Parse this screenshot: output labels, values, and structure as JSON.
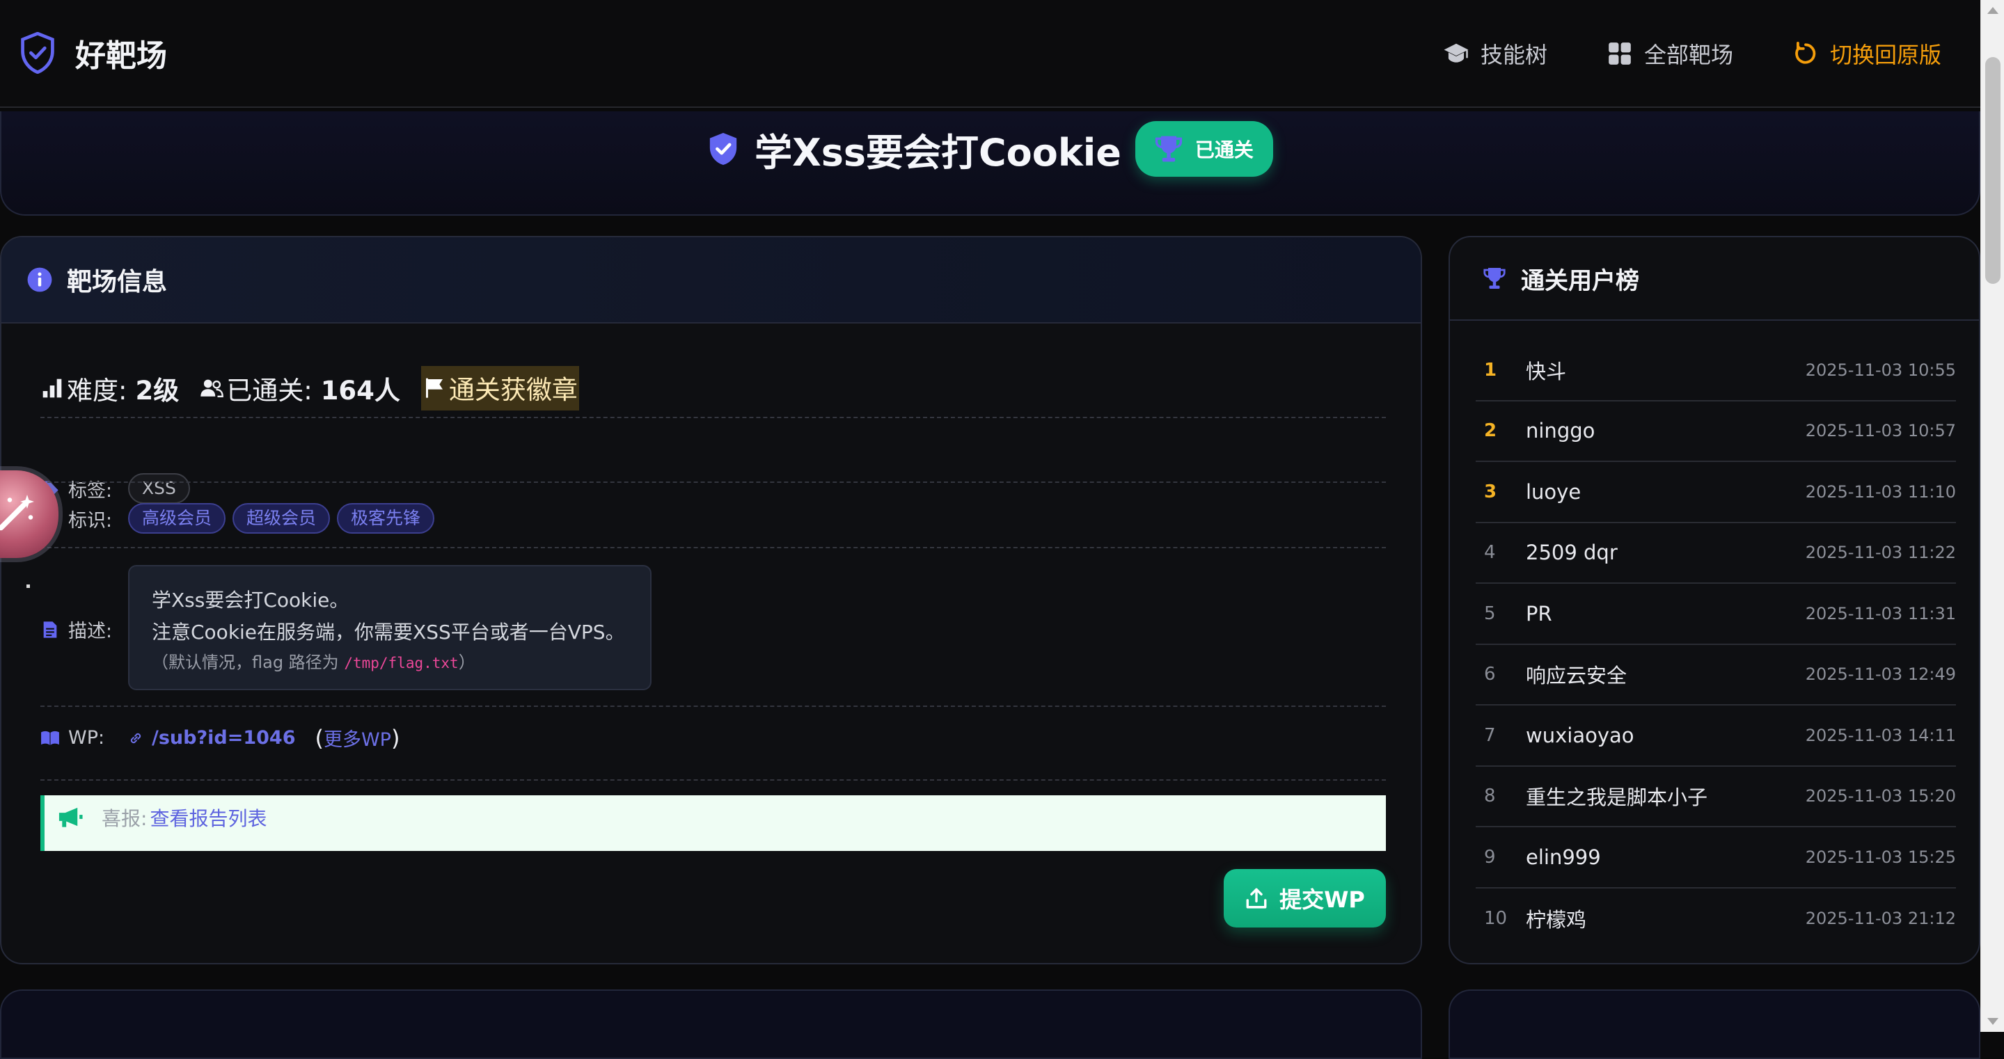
{
  "nav": {
    "brand": "好靶场",
    "skill_tree": "技能树",
    "all_ranges": "全部靶场",
    "switch_version": "切换回原版"
  },
  "banner": {
    "title": "学Xss要会打Cookie",
    "status": "已通关"
  },
  "info": {
    "header": "靶场信息",
    "difficulty_label": "难度:",
    "difficulty_value": "2级",
    "passed_label": "已通关:",
    "passed_value": "164人",
    "medal": "通关获徽章",
    "tags_label": "标签:",
    "tags": [
      "XSS"
    ],
    "marks_label": "标识:",
    "marks": [
      "高级会员",
      "超级会员",
      "极客先锋"
    ],
    "desc_label": "描述:",
    "desc_line1": "学Xss要会打Cookie。",
    "desc_line2": "注意Cookie在服务端，你需要XSS平台或者一台VPS。",
    "desc_note_prefix": "（默认情况，flag 路径为 ",
    "desc_note_path": "/tmp/flag.txt",
    "desc_note_suffix": "）",
    "wp_label": "WP:",
    "wp_link": "/sub?id=1046",
    "paren_open": "(",
    "more_wp": "更多WP",
    "paren_close": ")",
    "report_label": "喜报:",
    "report_link": "查看报告列表",
    "submit": "提交WP"
  },
  "board": {
    "header": "通关用户榜",
    "rows": [
      {
        "rank": "1",
        "name": "快斗",
        "time": "2025-11-03 10:55"
      },
      {
        "rank": "2",
        "name": "ninggo",
        "time": "2025-11-03 10:57"
      },
      {
        "rank": "3",
        "name": "luoye",
        "time": "2025-11-03 11:10"
      },
      {
        "rank": "4",
        "name": "2509 dqr",
        "time": "2025-11-03 11:22"
      },
      {
        "rank": "5",
        "name": "PR",
        "time": "2025-11-03 11:31"
      },
      {
        "rank": "6",
        "name": "响应云安全",
        "time": "2025-11-03 12:49"
      },
      {
        "rank": "7",
        "name": "wuxiaoyao",
        "time": "2025-11-03 14:11"
      },
      {
        "rank": "8",
        "name": "重生之我是脚本小子",
        "time": "2025-11-03 15:20"
      },
      {
        "rank": "9",
        "name": "elin999",
        "time": "2025-11-03 15:25"
      },
      {
        "rank": "10",
        "name": "柠檬鸡",
        "time": "2025-11-03 21:12"
      }
    ]
  },
  "colors": {
    "accent": "#6366f1",
    "success": "#12b886",
    "warning": "#f59e0b",
    "gold_rank": "#f5b325"
  },
  "icons": {
    "brand": "shield-check-icon",
    "skill_tree": "graduation-cap-icon",
    "all_ranges": "grid-icon",
    "switch": "rotate-icon",
    "trophy": "trophy-icon",
    "info": "info-circle-icon"
  }
}
